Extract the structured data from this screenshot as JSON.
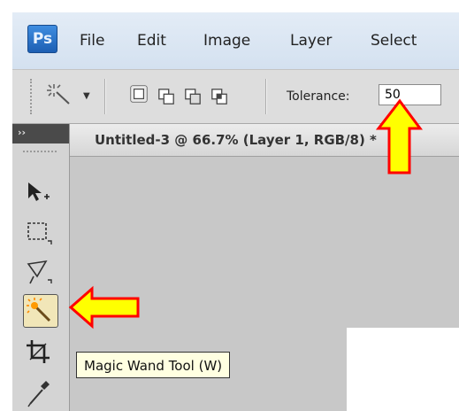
{
  "app": {
    "logo": "Ps"
  },
  "menu": {
    "items": [
      "File",
      "Edit",
      "Image",
      "Layer",
      "Select"
    ]
  },
  "options_bar": {
    "tool_icon": "magic-wand-icon",
    "selection_modes": [
      "new-selection-icon",
      "add-to-selection-icon",
      "subtract-from-selection-icon",
      "intersect-selection-icon"
    ],
    "tolerance_label": "Tolerance:",
    "tolerance_value": "50"
  },
  "tools_panel": {
    "collapse_glyph": "››",
    "tools": [
      "move-tool-icon",
      "marquee-tool-icon",
      "lasso-tool-icon",
      "magic-wand-tool-icon",
      "crop-tool-icon",
      "eyedropper-tool-icon"
    ],
    "active_tool": "magic-wand-tool-icon"
  },
  "document": {
    "tab_title": "Untitled-3 @ 66.7% (Layer 1, RGB/8) *",
    "close_glyph": "×"
  },
  "tooltip": {
    "text": "Magic Wand Tool (W)"
  },
  "annotations": {
    "arrow_fill": "#ffff00",
    "arrow_stroke": "#ff0000"
  }
}
